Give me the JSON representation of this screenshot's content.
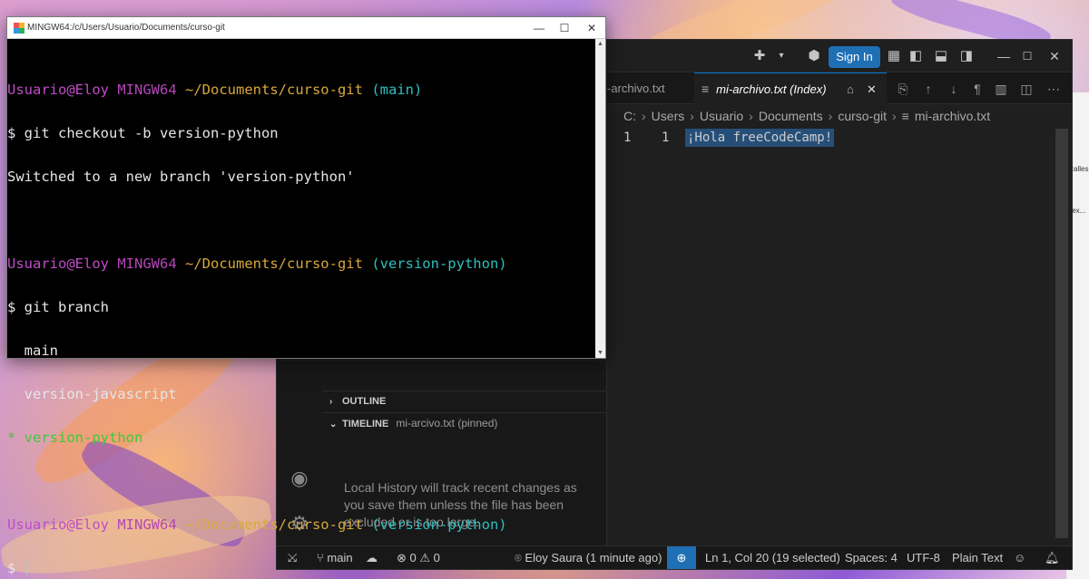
{
  "bash": {
    "title": "MINGW64:/c/Users/Usuario/Documents/curso-git",
    "minimize": "—",
    "maximize": "☐",
    "close": "✕",
    "lines": [
      {
        "user": "Usuario@Eloy",
        "mingw": "MINGW64",
        "path": "~/Documents/curso-git",
        "branch": "(main)"
      },
      {
        "text": "$ git checkout -b version-python"
      },
      {
        "text": "Switched to a new branch 'version-python'"
      },
      {
        "text": ""
      },
      {
        "user": "Usuario@Eloy",
        "mingw": "MINGW64",
        "path": "~/Documents/curso-git",
        "branch": "(version-python)"
      },
      {
        "text": "$ git branch"
      },
      {
        "text": "  main"
      },
      {
        "text": "  version-javascript"
      },
      {
        "current": "* version-python"
      },
      {
        "text": ""
      },
      {
        "user": "Usuario@Eloy",
        "mingw": "MINGW64",
        "path": "~/Documents/curso-git",
        "branch": "(version-python)"
      },
      {
        "prompt": "$ "
      }
    ]
  },
  "vscode": {
    "sign_in": "Sign In",
    "tabs": [
      {
        "label": "-archivo.txt",
        "active": false
      },
      {
        "label": "mi-archivo.txt (Index)",
        "active": true
      }
    ],
    "breadcrumb": [
      "C:",
      "Users",
      "Usuario",
      "Documents",
      "curso-git",
      "mi-archivo.txt"
    ],
    "editor": {
      "line_original": "1",
      "line_modified": "1",
      "code": "¡Hola freeCodeCamp!"
    },
    "sidebar": {
      "outline": "OUTLINE",
      "timeline": "TIMELINE",
      "timeline_file": "mi-arcivo.txt (pinned)",
      "timeline_message": "Local History will track recent changes as you save them unless the file has been excluded or is too large."
    },
    "statusbar": {
      "branch": "main",
      "errors": "0",
      "warnings": "0",
      "blame": "Eloy Saura (1 minute ago)",
      "position": "Ln 1, Col 20 (19 selected)",
      "spaces": "Spaces: 4",
      "encoding": "UTF-8",
      "language": "Plain Text"
    }
  },
  "peek": {
    "text1": "zalles",
    "text2": "tex..."
  }
}
